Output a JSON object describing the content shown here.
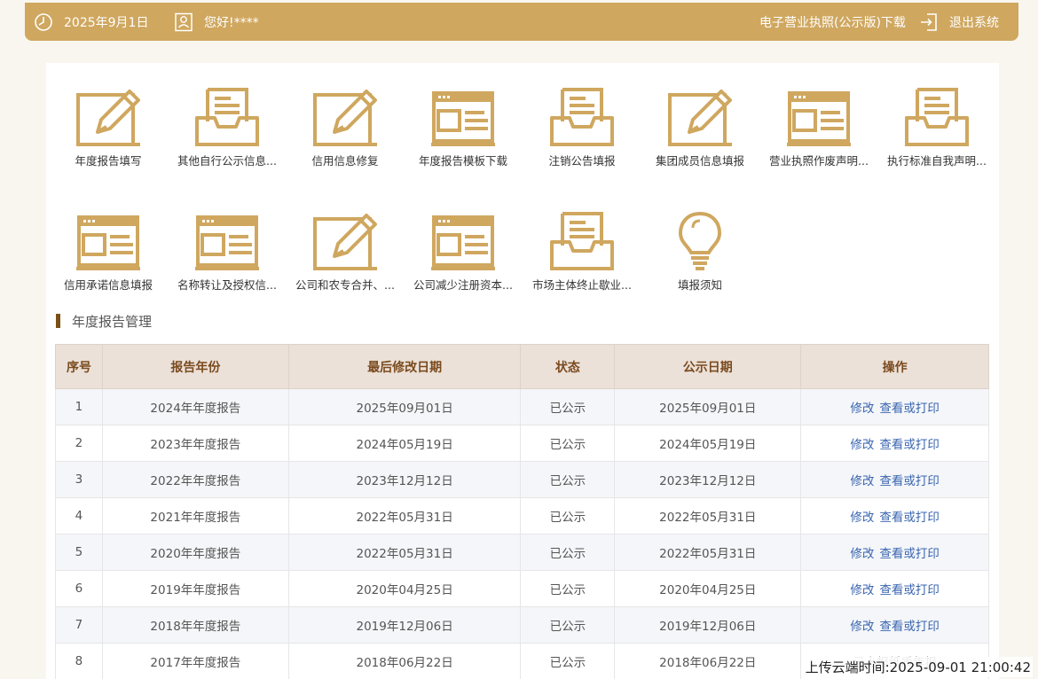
{
  "colors": {
    "topbar": "#cfa75f",
    "icon": "#cfa75f",
    "link": "#3b66b0",
    "section_bar": "#7a4f16"
  },
  "topbar": {
    "date": "2025年9月1日",
    "greeting": "您好!****",
    "download": "电子营业执照(公示版)下载",
    "logout": "退出系统"
  },
  "tiles": [
    {
      "label": "年度报告填写",
      "icon": "edit-pencil-icon"
    },
    {
      "label": "其他自行公示信息...",
      "icon": "inbox-tray-icon"
    },
    {
      "label": "信用信息修复",
      "icon": "edit-pencil-icon"
    },
    {
      "label": "年度报告模板下载",
      "icon": "template-form-icon"
    },
    {
      "label": "注销公告填报",
      "icon": "inbox-tray-icon"
    },
    {
      "label": "集团成员信息填报",
      "icon": "edit-pencil-icon"
    },
    {
      "label": "营业执照作废声明...",
      "icon": "template-form-icon"
    },
    {
      "label": "执行标准自我声明...",
      "icon": "inbox-tray-icon"
    },
    {
      "label": "信用承诺信息填报",
      "icon": "template-form-icon"
    },
    {
      "label": "名称转让及授权信...",
      "icon": "template-form-icon"
    },
    {
      "label": "公司和农专合并、...",
      "icon": "edit-pencil-icon"
    },
    {
      "label": "公司减少注册资本...",
      "icon": "template-form-icon"
    },
    {
      "label": "市场主体终止歇业...",
      "icon": "inbox-tray-icon"
    },
    {
      "label": "填报须知",
      "icon": "lightbulb-icon"
    }
  ],
  "section": {
    "title": "年度报告管理"
  },
  "table": {
    "headers": [
      "序号",
      "报告年份",
      "最后修改日期",
      "状态",
      "公示日期",
      "操作"
    ],
    "rows": [
      {
        "no": "1",
        "year": "2024年年度报告",
        "modified": "2025年09月01日",
        "status": "已公示",
        "published": "2025年09月01日",
        "actions": [
          "修改",
          "查看或打印"
        ]
      },
      {
        "no": "2",
        "year": "2023年年度报告",
        "modified": "2024年05月19日",
        "status": "已公示",
        "published": "2024年05月19日",
        "actions": [
          "修改",
          "查看或打印"
        ]
      },
      {
        "no": "3",
        "year": "2022年年度报告",
        "modified": "2023年12月12日",
        "status": "已公示",
        "published": "2023年12月12日",
        "actions": [
          "修改",
          "查看或打印"
        ]
      },
      {
        "no": "4",
        "year": "2021年年度报告",
        "modified": "2022年05月31日",
        "status": "已公示",
        "published": "2022年05月31日",
        "actions": [
          "修改",
          "查看或打印"
        ]
      },
      {
        "no": "5",
        "year": "2020年年度报告",
        "modified": "2022年05月31日",
        "status": "已公示",
        "published": "2022年05月31日",
        "actions": [
          "修改",
          "查看或打印"
        ]
      },
      {
        "no": "6",
        "year": "2019年年度报告",
        "modified": "2020年04月25日",
        "status": "已公示",
        "published": "2020年04月25日",
        "actions": [
          "修改",
          "查看或打印"
        ]
      },
      {
        "no": "7",
        "year": "2018年年度报告",
        "modified": "2019年12月06日",
        "status": "已公示",
        "published": "2019年12月06日",
        "actions": [
          "修改",
          "查看或打印"
        ]
      },
      {
        "no": "8",
        "year": "2017年年度报告",
        "modified": "2018年06月22日",
        "status": "已公示",
        "published": "2018年06月22日",
        "note": "已上报纸质年报"
      }
    ]
  },
  "overlay": {
    "upload_time": "上传云端时间:2025-09-01 21:00:42"
  }
}
